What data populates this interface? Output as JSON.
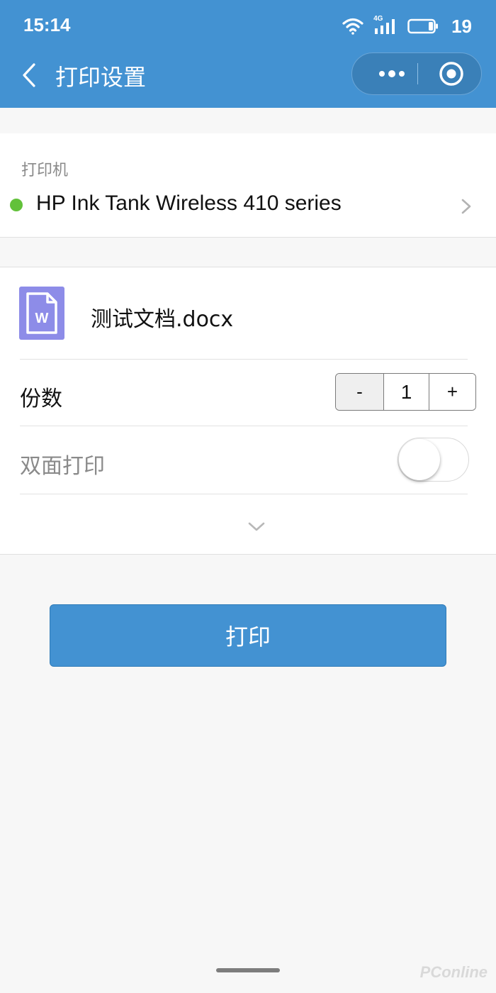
{
  "status_bar": {
    "time": "15:14",
    "network": "4G",
    "battery_level": "19",
    "icons": [
      "wifi-icon",
      "signal-icon",
      "battery-icon"
    ]
  },
  "nav": {
    "title": "打印设置",
    "back_icon": "chevron-left-icon",
    "more_icon": "more-dots-icon",
    "close_icon": "target-close-icon"
  },
  "printer": {
    "label": "打印机",
    "name": "HP Ink Tank Wireless 410 series",
    "status_color": "#62c13a"
  },
  "document": {
    "icon_letter": "W",
    "name": "测试文档.docx"
  },
  "copies": {
    "label": "份数",
    "minus": "-",
    "value": "1",
    "plus": "+"
  },
  "duplex": {
    "label": "双面打印",
    "enabled": false
  },
  "print_button": {
    "label": "打印"
  },
  "watermark": "PConline",
  "colors": {
    "accent": "#4392d2",
    "doc_icon": "#8d8ce8"
  }
}
